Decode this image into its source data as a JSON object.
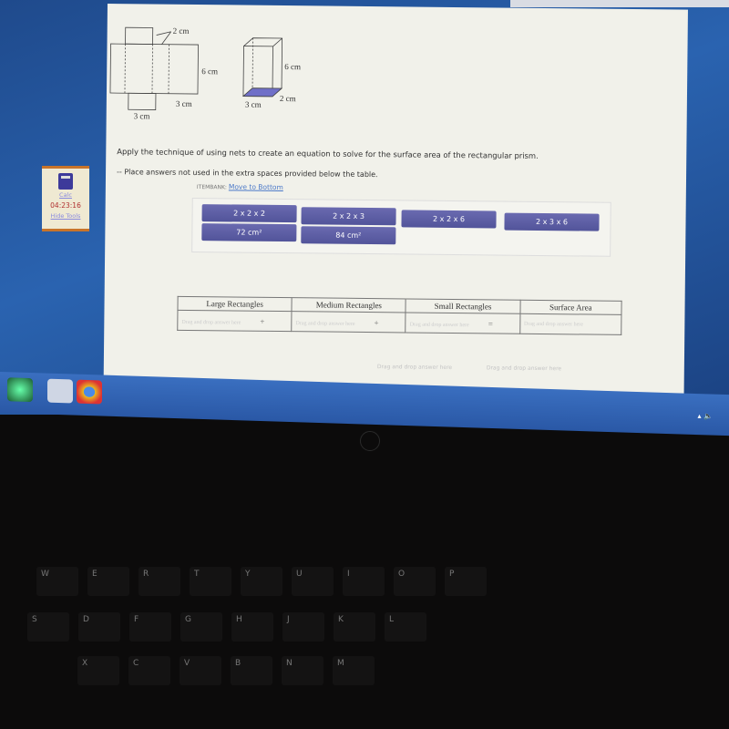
{
  "figure": {
    "net_labels": {
      "top_width": "2 cm",
      "height": "6 cm",
      "side_width": "3 cm",
      "bottom_width": "3 cm"
    },
    "prism_labels": {
      "height": "6 cm",
      "depth": "2 cm",
      "width": "3 cm"
    },
    "base_fill_color": "#7070c8"
  },
  "question": {
    "instruction": "Apply the technique of using nets to create an equation to solve for the surface area of the rectangular prism.",
    "note": "-- Place answers not used in the extra spaces provided below the table."
  },
  "itembank": {
    "label": "ITEMBANK:",
    "move_link": "Move to Bottom",
    "tiles": [
      "2 x 2 x 2",
      "2 x 2 x 3",
      "2 x 2 x 6",
      "2 x 3 x 6",
      "72 cm²",
      "84 cm²"
    ],
    "tile_color": "#5c5ea6"
  },
  "table": {
    "headers": [
      "Large Rectangles",
      "Medium Rectangles",
      "Small Rectangles",
      "Surface Area"
    ],
    "placeholder": "Drag and drop answer here",
    "operators": [
      "+",
      "+",
      "="
    ]
  },
  "extra_spaces": [
    "Drag and drop answer here",
    "Drag and drop answer here"
  ],
  "tools": {
    "calc_label": "Calc",
    "timer": "04:23:16",
    "hide_label": "Hide Tools"
  },
  "keyboard": {
    "keys": [
      "W",
      "E",
      "R",
      "T",
      "Y",
      "U",
      "I",
      "O",
      "P",
      "S",
      "D",
      "F",
      "G",
      "H",
      "J",
      "K",
      "L",
      "X",
      "C",
      "V",
      "B",
      "N",
      "M"
    ]
  }
}
